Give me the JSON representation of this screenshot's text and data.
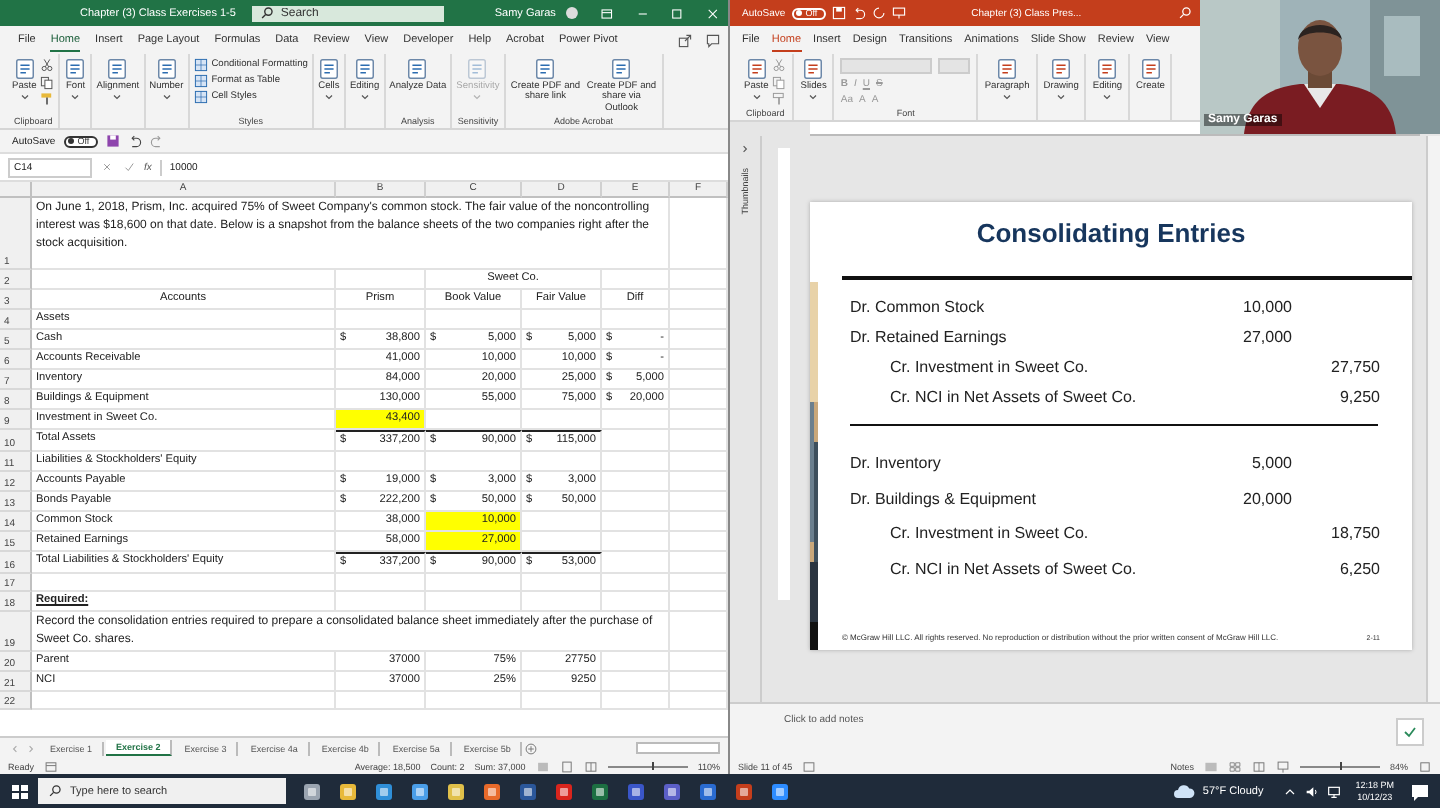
{
  "excel": {
    "title": "Chapter (3) Class Exercises 1-5",
    "search": {
      "placeholder": "Search"
    },
    "user": "Samy Garas",
    "tabs": [
      {
        "label": "File",
        "selected": false
      },
      {
        "label": "Home",
        "selected": true
      },
      {
        "label": "Insert",
        "selected": false
      },
      {
        "label": "Page Layout",
        "selected": false
      },
      {
        "label": "Formulas",
        "selected": false
      },
      {
        "label": "Data",
        "selected": false
      },
      {
        "label": "Review",
        "selected": false
      },
      {
        "label": "View",
        "selected": false
      },
      {
        "label": "Developer",
        "selected": false
      },
      {
        "label": "Help",
        "selected": false
      },
      {
        "label": "Acrobat",
        "selected": false
      },
      {
        "label": "Power Pivot",
        "selected": false
      }
    ],
    "ribbon": [
      {
        "kind": "clipboard",
        "label": "Clipboard",
        "buttons": [
          {
            "label": "Paste",
            "dropdown": true,
            "disabled": false
          }
        ]
      },
      {
        "kind": "buttons",
        "buttons": [
          {
            "label": "Font",
            "dropdown": true,
            "disabled": false
          }
        ]
      },
      {
        "kind": "buttons",
        "buttons": [
          {
            "label": "Alignment",
            "dropdown": true,
            "disabled": false
          }
        ]
      },
      {
        "kind": "buttons",
        "buttons": [
          {
            "label": "Number",
            "dropdown": true,
            "disabled": false
          }
        ]
      },
      {
        "kind": "styles",
        "label": "Styles",
        "items": [
          "Conditional Formatting",
          "Format as Table",
          "Cell Styles"
        ]
      },
      {
        "kind": "buttons",
        "buttons": [
          {
            "label": "Cells",
            "dropdown": true,
            "disabled": false
          }
        ]
      },
      {
        "kind": "buttons",
        "buttons": [
          {
            "label": "Editing",
            "dropdown": true,
            "disabled": false
          }
        ]
      },
      {
        "kind": "buttons",
        "label": "Analysis",
        "buttons": [
          {
            "label": "Analyze Data",
            "dropdown": false,
            "disabled": false
          }
        ]
      },
      {
        "kind": "buttons",
        "label": "Sensitivity",
        "buttons": [
          {
            "label": "Sensitivity",
            "dropdown": true,
            "disabled": true
          }
        ]
      },
      {
        "kind": "buttons",
        "label": "Adobe Acrobat",
        "buttons": [
          {
            "label": "Create PDF and share link",
            "dropdown": false,
            "disabled": false
          },
          {
            "label": "Create PDF and share via Outlook",
            "dropdown": false,
            "disabled": false
          }
        ]
      }
    ],
    "autosave": {
      "label": "AutoSave",
      "state": "Off",
      "on": false
    },
    "formula_bar": {
      "name_box": "C14",
      "function": "fx",
      "value": "10000"
    },
    "columns": [
      "A",
      "B",
      "C",
      "D",
      "E",
      "F"
    ],
    "rows": [
      {
        "num": "1",
        "kind": "paragraph",
        "text": "On June 1, 2018, Prism, Inc. acquired 75% of Sweet Company's common stock. The fair value of the noncontrolling interest was $18,600 on that date. Below is a snapshot from the balance sheets of the two companies right after the stock acquisition."
      },
      {
        "num": "2",
        "kind": "group_header",
        "text": "Sweet Co."
      },
      {
        "num": "3",
        "kind": "header",
        "cells": [
          {
            "text": "Accounts"
          },
          {
            "text": "Prism"
          },
          {
            "text": "Book Value"
          },
          {
            "text": "Fair Value"
          },
          {
            "text": "Diff"
          }
        ]
      },
      {
        "num": "4",
        "kind": "data",
        "cells": [
          {
            "text": "Assets"
          },
          null,
          null,
          null,
          null
        ]
      },
      {
        "num": "5",
        "kind": "data",
        "cells": [
          {
            "text": "Cash"
          },
          {
            "currency": "$",
            "text": "38,800"
          },
          {
            "currency": "$",
            "text": "5,000"
          },
          {
            "currency": "$",
            "text": "5,000"
          },
          {
            "currency": "$",
            "text": "-"
          }
        ]
      },
      {
        "num": "6",
        "kind": "data",
        "cells": [
          {
            "text": "Accounts Receivable"
          },
          {
            "text": "41,000"
          },
          {
            "text": "10,000"
          },
          {
            "text": "10,000"
          },
          {
            "currency": "$",
            "text": "-"
          }
        ]
      },
      {
        "num": "7",
        "kind": "data",
        "cells": [
          {
            "text": "Inventory"
          },
          {
            "text": "84,000"
          },
          {
            "text": "20,000"
          },
          {
            "text": "25,000"
          },
          {
            "currency": "$",
            "text": "5,000"
          }
        ]
      },
      {
        "num": "8",
        "kind": "data",
        "cells": [
          {
            "text": "Buildings & Equipment"
          },
          {
            "text": "130,000"
          },
          {
            "text": "55,000"
          },
          {
            "text": "75,000"
          },
          {
            "currency": "$",
            "text": "20,000"
          }
        ]
      },
      {
        "num": "9",
        "kind": "data",
        "cells": [
          {
            "text": "Investment in Sweet Co."
          },
          {
            "text": "43,400",
            "highlight": true
          },
          null,
          null,
          null
        ]
      },
      {
        "num": "10",
        "kind": "total",
        "cells": [
          {
            "text": "Total Assets"
          },
          {
            "currency": "$",
            "text": "337,200"
          },
          {
            "currency": "$",
            "text": "90,000"
          },
          {
            "currency": "$",
            "text": "115,000"
          },
          null
        ]
      },
      {
        "num": "11",
        "kind": "data",
        "cells": [
          {
            "text": "Liabilities & Stockholders' Equity"
          },
          null,
          null,
          null,
          null
        ]
      },
      {
        "num": "12",
        "kind": "data",
        "cells": [
          {
            "text": "Accounts Payable"
          },
          {
            "currency": "$",
            "text": "19,000"
          },
          {
            "currency": "$",
            "text": "3,000"
          },
          {
            "currency": "$",
            "text": "3,000"
          },
          null
        ]
      },
      {
        "num": "13",
        "kind": "data",
        "cells": [
          {
            "text": "Bonds Payable"
          },
          {
            "currency": "$",
            "text": "222,200"
          },
          {
            "currency": "$",
            "text": "50,000"
          },
          {
            "currency": "$",
            "text": "50,000"
          },
          null
        ]
      },
      {
        "num": "14",
        "kind": "data",
        "cells": [
          {
            "text": "Common Stock"
          },
          {
            "text": "38,000"
          },
          {
            "text": "10,000",
            "highlight": true
          },
          null,
          null
        ]
      },
      {
        "num": "15",
        "kind": "data",
        "cells": [
          {
            "text": "Retained Earnings"
          },
          {
            "text": "58,000"
          },
          {
            "text": "27,000",
            "highlight": true
          },
          null,
          null
        ]
      },
      {
        "num": "16",
        "kind": "total",
        "cells": [
          {
            "text": "Total Liabilities & Stockholders' Equity"
          },
          {
            "currency": "$",
            "text": "337,200"
          },
          {
            "currency": "$",
            "text": "90,000"
          },
          {
            "currency": "$",
            "text": "53,000"
          },
          null
        ]
      },
      {
        "num": "17",
        "kind": "data"
      },
      {
        "num": "18",
        "kind": "heading",
        "text": "Required:"
      },
      {
        "num": "19",
        "kind": "paragraph",
        "text": "Record the consolidation entries required to prepare a consolidated balance sheet immediately after the purchase of Sweet Co. shares."
      },
      {
        "num": "20",
        "kind": "data",
        "cells": [
          {
            "text": "Parent"
          },
          {
            "text": "37000"
          },
          {
            "text": "75%"
          },
          {
            "text": "27750"
          },
          null
        ]
      },
      {
        "num": "21",
        "kind": "data",
        "cells": [
          {
            "text": "NCI"
          },
          {
            "text": "37000"
          },
          {
            "text": "25%"
          },
          {
            "text": "9250"
          },
          null
        ]
      },
      {
        "num": "22",
        "kind": "data"
      }
    ],
    "sheets": [
      {
        "label": "Exercise 1",
        "selected": false
      },
      {
        "label": "Exercise 2",
        "selected": true
      },
      {
        "label": "Exercise 3",
        "selected": false
      },
      {
        "label": "Exercise 4a",
        "selected": false
      },
      {
        "label": "Exercise 4b",
        "selected": false
      },
      {
        "label": "Exercise 5a",
        "selected": false
      },
      {
        "label": "Exercise 5b",
        "selected": false
      }
    ],
    "status": {
      "mode": "Ready",
      "average": "Average: 18,500",
      "count": "Count: 2",
      "sum": "Sum: 37,000",
      "zoom": "110%"
    },
    "zoom_slider": {
      "level": 0.55
    }
  },
  "powerpoint": {
    "title": "Chapter (3) Class Pres...",
    "autosave": {
      "label": "AutoSave",
      "state": "Off",
      "on": false
    },
    "tabs": [
      {
        "label": "File",
        "selected": false
      },
      {
        "label": "Home",
        "selected": true
      },
      {
        "label": "Insert",
        "selected": false
      },
      {
        "label": "Design",
        "selected": false
      },
      {
        "label": "Transitions",
        "selected": false
      },
      {
        "label": "Animations",
        "selected": false
      },
      {
        "label": "Slide Show",
        "selected": false
      },
      {
        "label": "Review",
        "selected": false
      },
      {
        "label": "View",
        "selected": false
      }
    ],
    "ribbon": [
      {
        "kind": "clipboard",
        "label": "Clipboard",
        "buttons": [
          {
            "label": "Paste",
            "dropdown": true,
            "disabled": false
          }
        ]
      },
      {
        "kind": "buttons",
        "buttons": [
          {
            "label": "Slides",
            "dropdown": true,
            "disabled": false
          }
        ]
      },
      {
        "kind": "font",
        "label": "Font",
        "format_buttons": [
          "B",
          "I",
          "U",
          "S"
        ],
        "size_buttons": [
          "Aa",
          "A",
          "A"
        ]
      },
      {
        "kind": "buttons",
        "buttons": [
          {
            "label": "Paragraph",
            "dropdown": true,
            "disabled": false
          }
        ]
      },
      {
        "kind": "buttons",
        "buttons": [
          {
            "label": "Drawing",
            "dropdown": true,
            "disabled": false
          }
        ]
      },
      {
        "kind": "buttons",
        "buttons": [
          {
            "label": "Editing",
            "dropdown": true,
            "disabled": false
          }
        ]
      },
      {
        "kind": "buttons",
        "buttons": [
          {
            "label": "Create",
            "dropdown": false,
            "disabled": false
          }
        ]
      }
    ],
    "thumbnails_label": "Thumbnails",
    "slide": {
      "title": "Consolidating Entries",
      "groups": [
        [
          {
            "kind": "debit",
            "label": "Dr. Common Stock",
            "amount": "10,000"
          },
          {
            "kind": "debit",
            "label": "Dr. Retained Earnings",
            "amount": "27,000"
          },
          {
            "kind": "credit",
            "label": "Cr. Investment in Sweet Co.",
            "amount": "27,750"
          },
          {
            "kind": "credit",
            "label": "Cr. NCI in Net Assets of Sweet Co.",
            "amount": "9,250"
          }
        ],
        [
          {
            "kind": "debit",
            "label": "Dr. Inventory",
            "amount": "5,000"
          },
          {
            "kind": "debit",
            "label": "Dr. Buildings & Equipment",
            "amount": "20,000"
          },
          {
            "kind": "credit",
            "label": "Cr. Investment in Sweet Co.",
            "amount": "18,750"
          },
          {
            "kind": "credit",
            "label": "Cr. NCI in Net Assets of Sweet Co.",
            "amount": "6,250"
          }
        ]
      ],
      "footer": "© McGraw Hill LLC. All rights reserved. No reproduction or distribution without the prior written consent of McGraw Hill LLC.",
      "page": "2-11"
    },
    "notes": {
      "placeholder": "Click to add notes"
    },
    "status": {
      "slide": "Slide 11 of 45",
      "notes": "Notes",
      "zoom": "84%"
    },
    "zoom_slider": {
      "level": 0.5
    }
  },
  "webcam": {
    "name": "Samy Garas"
  },
  "taskbar": {
    "search": {
      "placeholder": "Type here to search"
    },
    "weather": "57°F Cloudy",
    "time": "12:18 PM",
    "date": "10/12/23"
  }
}
